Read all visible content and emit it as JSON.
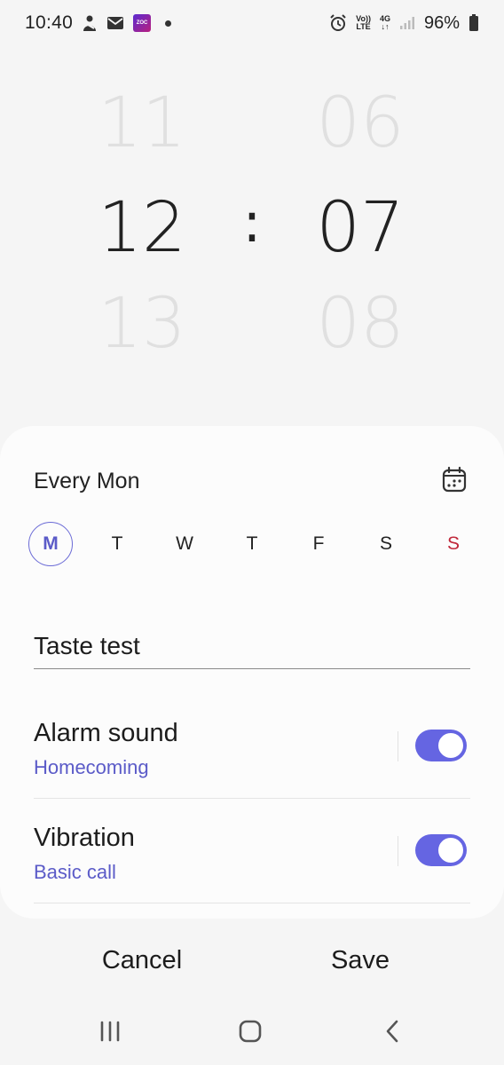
{
  "status_bar": {
    "time": "10:40",
    "network_top": "Vo))",
    "network_bottom": "LTE",
    "data_top": "4G",
    "data_bottom": "↓↑",
    "battery": "96%",
    "app_tile": "ZOC"
  },
  "picker": {
    "hours": {
      "above": "11",
      "selected": "12",
      "below": "13"
    },
    "separator": ":",
    "minutes": {
      "above": "06",
      "selected": "07",
      "below": "08"
    }
  },
  "repeat": {
    "summary": "Every Mon",
    "days": [
      {
        "label": "M",
        "selected": true
      },
      {
        "label": "T",
        "selected": false
      },
      {
        "label": "W",
        "selected": false
      },
      {
        "label": "T",
        "selected": false
      },
      {
        "label": "F",
        "selected": false
      },
      {
        "label": "S",
        "selected": false
      },
      {
        "label": "S",
        "selected": false
      }
    ]
  },
  "alarm_name": {
    "value": "Taste test"
  },
  "options": {
    "alarm_sound": {
      "title": "Alarm sound",
      "value": "Homecoming",
      "enabled": true
    },
    "vibration": {
      "title": "Vibration",
      "value": "Basic call",
      "enabled": true
    }
  },
  "actions": {
    "cancel": "Cancel",
    "save": "Save"
  },
  "colors": {
    "accent": "#6565e2",
    "accent_text": "#5b5bc8",
    "sunday": "#c0283a",
    "background": "#f5f5f5",
    "card": "#fcfcfc"
  },
  "icons": {
    "calendar": "calendar-icon",
    "recents": "recents-icon",
    "home": "home-icon",
    "back": "back-icon"
  }
}
